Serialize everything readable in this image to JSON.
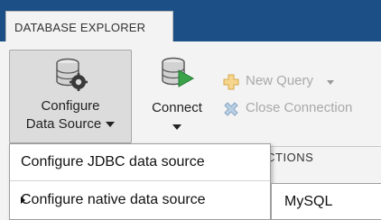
{
  "tabs": {
    "active": "DATABASE EXPLORER"
  },
  "ribbon": {
    "configure": {
      "line1": "Configure",
      "line2": "Data Source"
    },
    "connect": {
      "label": "Connect"
    },
    "new_query": "New Query",
    "close_connection": "Close Connection",
    "section_label": "ECTIONS"
  },
  "menu": {
    "items": [
      {
        "label": "Configure JDBC data source"
      },
      {
        "label": "Configure native data source"
      }
    ]
  },
  "submenu": {
    "items": [
      {
        "label": "MySQL"
      }
    ]
  },
  "icons": {
    "configure": "database-gear-icon",
    "connect": "database-connect-icon",
    "new_query": "new-query-icon",
    "close_connection": "close-connection-icon"
  },
  "colors": {
    "top_bar": "#1c4f86",
    "ribbon": "#f3f3f3",
    "pressed_button": "#dcdcdc",
    "connect_arrow": "#3aa34a"
  }
}
